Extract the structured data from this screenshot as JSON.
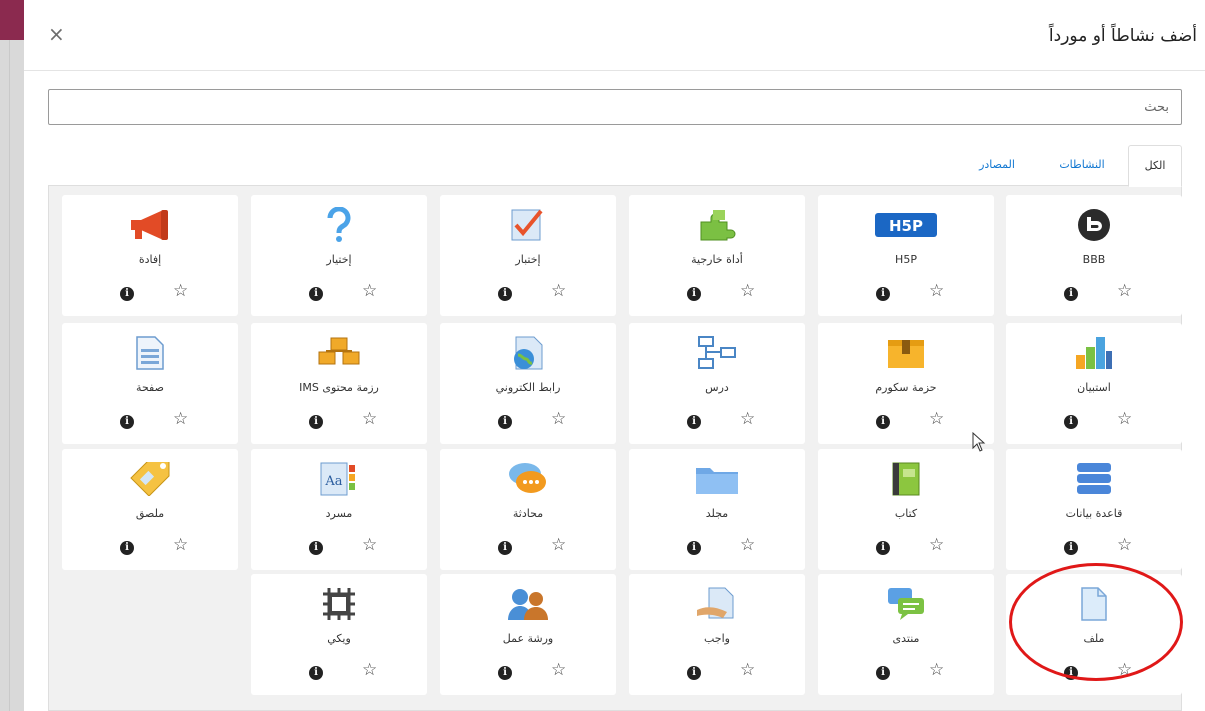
{
  "dialog": {
    "title": "أضف نشاطاً أو مورداً",
    "close_glyph": "×"
  },
  "search": {
    "placeholder": "بحث",
    "value": ""
  },
  "tabs": [
    {
      "label": "الكل",
      "active": true
    },
    {
      "label": "النشاطات",
      "active": false
    },
    {
      "label": "المصادر",
      "active": false
    }
  ],
  "cards": [
    {
      "label": "BBB",
      "icon": "bigbluebutton-icon"
    },
    {
      "label": "H5P",
      "icon": "h5p-icon"
    },
    {
      "label": "أداة خارجية",
      "icon": "puzzle-icon"
    },
    {
      "label": "إختبار",
      "icon": "quiz-icon"
    },
    {
      "label": "إختيار",
      "icon": "question-mark-icon"
    },
    {
      "label": "إفادة",
      "icon": "megaphone-icon"
    },
    {
      "label": "استبيان",
      "icon": "bar-chart-icon"
    },
    {
      "label": "حزمة سكورم",
      "icon": "package-box-icon"
    },
    {
      "label": "درس",
      "icon": "flowchart-icon"
    },
    {
      "label": "رابط الكتروني",
      "icon": "url-globe-icon"
    },
    {
      "label": "رزمة محتوى IMS",
      "icon": "ims-content-icon"
    },
    {
      "label": "صفحة",
      "icon": "page-icon"
    },
    {
      "label": "قاعدة بيانات",
      "icon": "database-icon"
    },
    {
      "label": "كتاب",
      "icon": "book-icon"
    },
    {
      "label": "مجلد",
      "icon": "folder-icon"
    },
    {
      "label": "محادثة",
      "icon": "chat-bubble-icon"
    },
    {
      "label": "مسرد",
      "icon": "glossary-icon"
    },
    {
      "label": "ملصق",
      "icon": "label-tag-icon"
    },
    {
      "label": "ملف",
      "icon": "file-icon"
    },
    {
      "label": "منتدى",
      "icon": "forum-icon"
    },
    {
      "label": "واجب",
      "icon": "assignment-icon"
    },
    {
      "label": "ورشة عمل",
      "icon": "workshop-icon"
    },
    {
      "label": "ويكي",
      "icon": "wiki-icon"
    }
  ],
  "card_actions": {
    "info_glyph": "i",
    "star_glyph": "☆"
  },
  "colors": {
    "link": "#1177d1",
    "highlight_circle": "#e01818",
    "panel_bg": "#f1f1f1"
  }
}
